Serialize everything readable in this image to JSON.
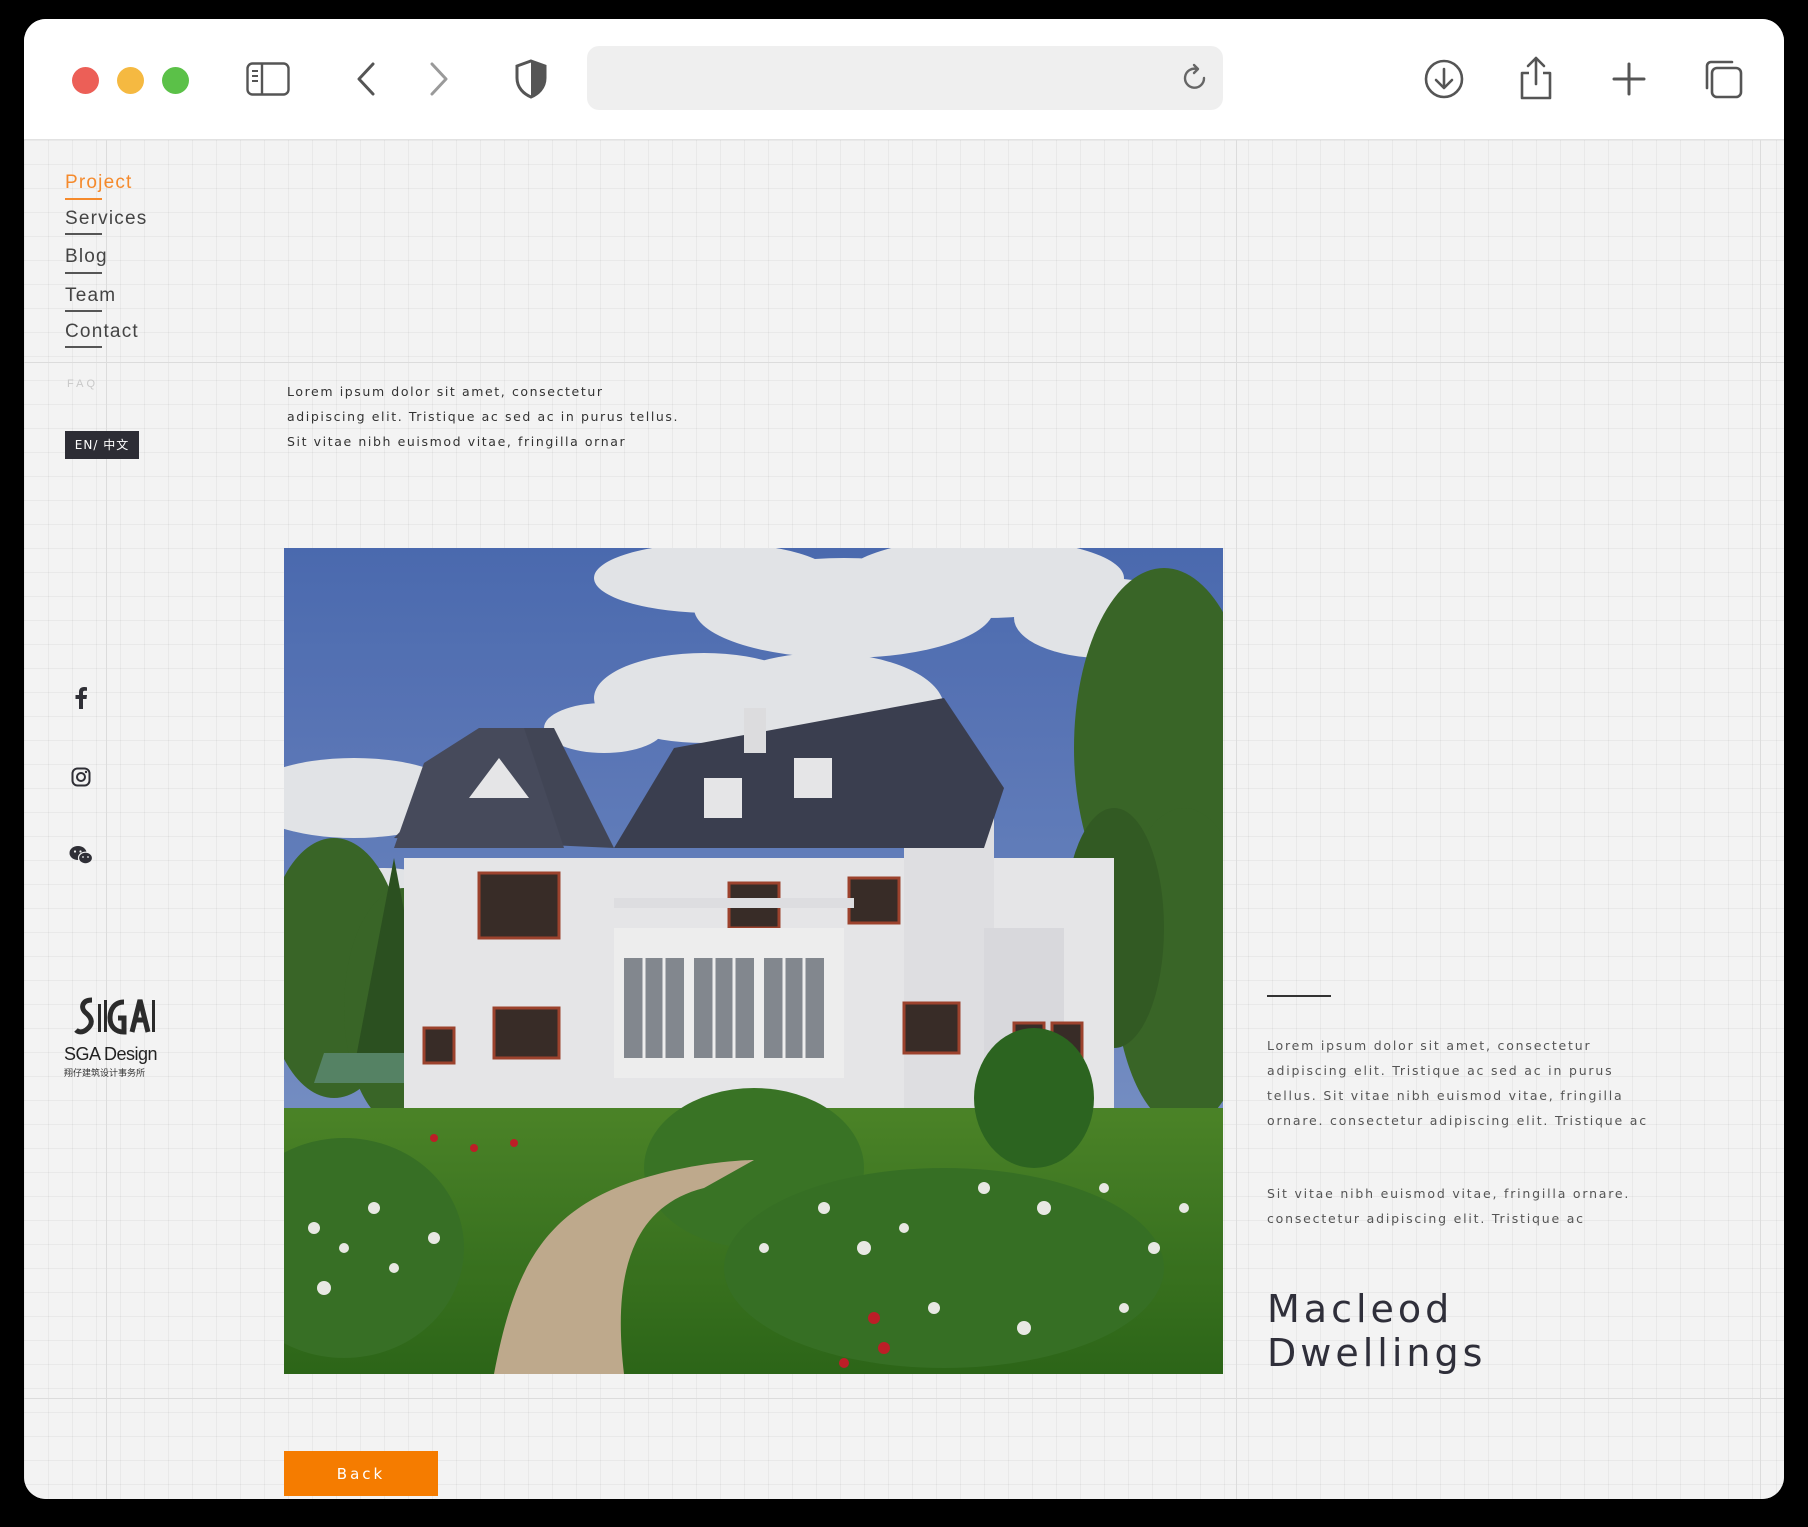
{
  "browser": {
    "traffic_lights": [
      "#ec5f57",
      "#f5b941",
      "#5bc148"
    ],
    "url": "",
    "icons": [
      "sidebar-icon",
      "back-icon",
      "forward-icon",
      "shield-icon",
      "reload-icon",
      "download-icon",
      "share-icon",
      "new-tab-icon",
      "tabs-icon"
    ]
  },
  "nav": {
    "items": [
      {
        "label": "Project",
        "active": true
      },
      {
        "label": "Services",
        "active": false
      },
      {
        "label": "Blog",
        "active": false
      },
      {
        "label": "Team",
        "active": false
      },
      {
        "label": "Contact",
        "active": false
      }
    ],
    "faq": "FAQ",
    "active_color": "#f58a2c"
  },
  "lang_toggle": "EN/ 中文",
  "social": [
    "facebook-icon",
    "instagram-icon",
    "wechat-icon"
  ],
  "logo": {
    "name": "SGA Design",
    "sub": "翔仔建筑设计事务所"
  },
  "intro": "Lorem ipsum dolor sit amet, consectetur adipiscing elit. Tristique ac sed ac in purus tellus. Sit vitae nibh euismod vitae, fringilla ornar",
  "description": {
    "p1": "Lorem ipsum dolor sit amet, consectetur adipiscing elit. Tristique ac sed ac in purus tellus. Sit vitae nibh euismod vitae, fringilla ornare. consectetur adipiscing elit. Tristique ac",
    "p2": "Sit vitae nibh euismod vitae, fringilla ornare. consectetur adipiscing elit. Tristique ac"
  },
  "project_title": "Macleod Dwellings",
  "back_label": "Back",
  "accent": "#f57c00"
}
